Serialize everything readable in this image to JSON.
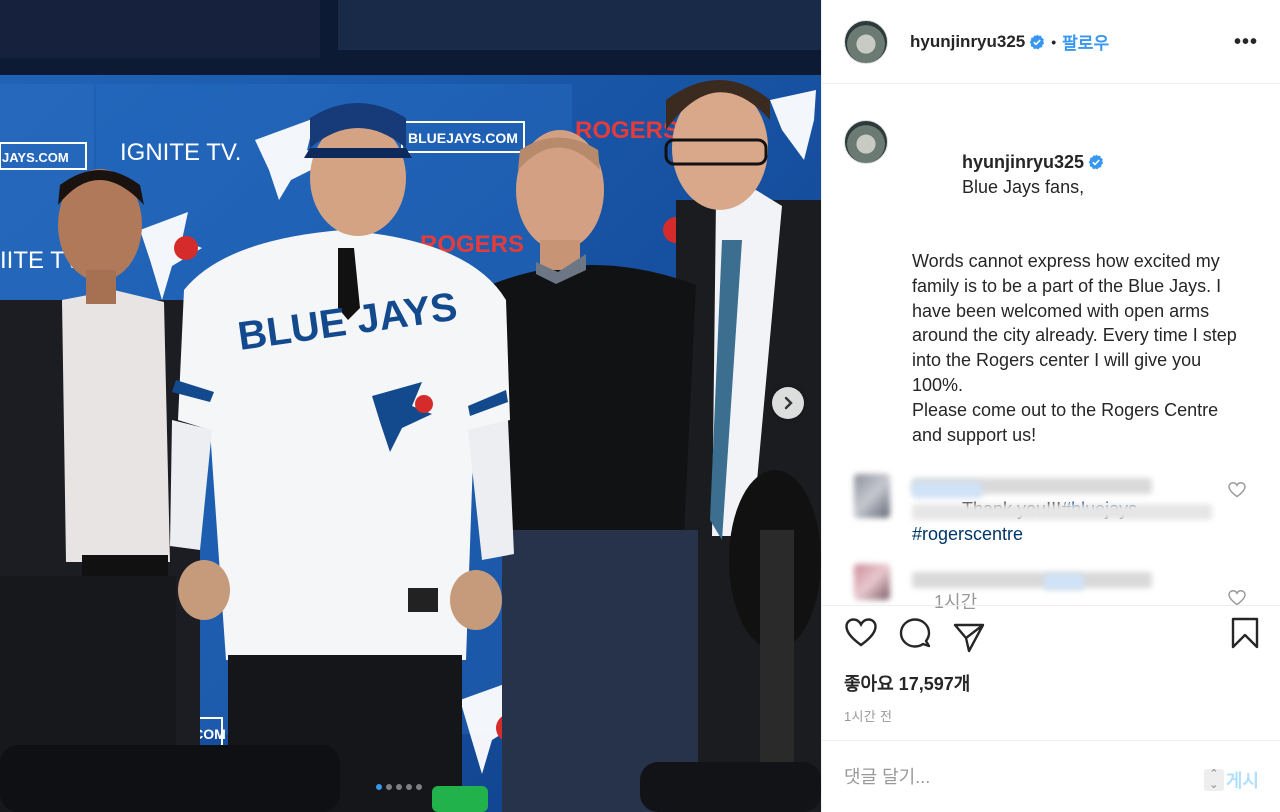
{
  "post": {
    "username": "hyunjinryu325",
    "follow_label": "팔로우",
    "separator": "•",
    "more_label": "•••",
    "photo_alt": "Hyun-Jin Ryu in Blue Jays jersey with three men at press conference",
    "caption_greeting": "Blue Jays fans,",
    "caption_text": "Words cannot express how excited my family is to be a part of the Blue Jays. I have been welcomed with open arms around the city already. Every time I step into the Rogers center I will give you 100%.\nPlease come out to the Rogers Centre and support us!",
    "caption_thanks": "Thank you!!!",
    "hashtags": [
      "#bluejays",
      "#rogerscentre"
    ],
    "caption_time": "1시간",
    "likes_label": "좋아요 17,597개",
    "posted_time": "1시간 전",
    "comment_placeholder": "댓글 달기...",
    "post_button": "게시"
  },
  "backdrop": {
    "sponsor_1": "IGNITE TV.",
    "sponsor_2": "BLUEJAYS.COM",
    "sponsor_3": "ROGERS",
    "jersey_text": "BLUE JAYS"
  },
  "carousel": {
    "total_slides": 5,
    "active_index": 0
  },
  "colors": {
    "accent": "#3897f0",
    "hashtag": "#003569",
    "bluejays_blue": "#134a8e"
  },
  "icons": [
    "verified-badge-icon",
    "more-options-icon",
    "heart-icon",
    "comment-icon",
    "share-icon",
    "bookmark-icon",
    "chevron-right-icon"
  ]
}
